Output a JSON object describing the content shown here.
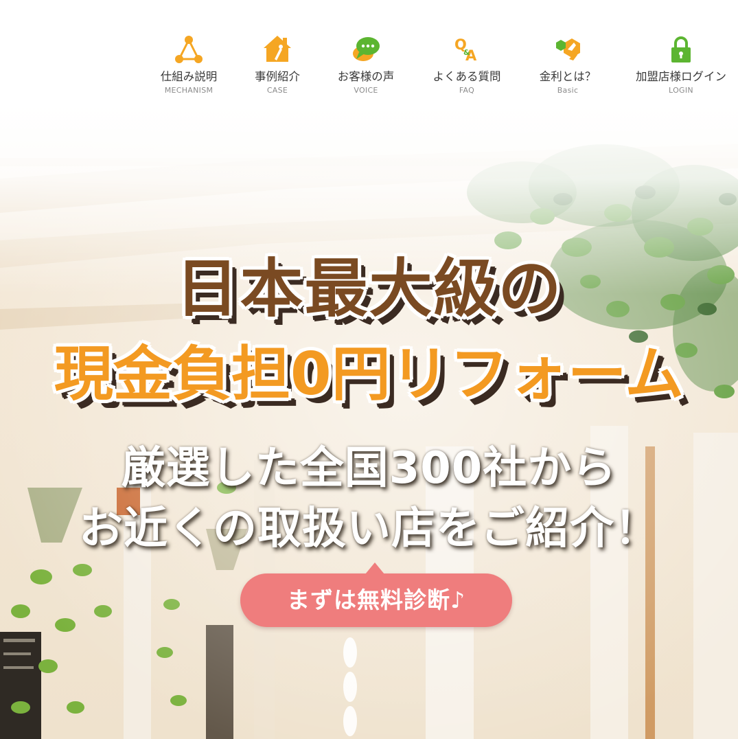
{
  "nav": {
    "items": [
      {
        "label": "仕組み説明",
        "sub": "MECHANISM",
        "icon": "mechanism-triangle-icon"
      },
      {
        "label": "事例紹介",
        "sub": "CASE",
        "icon": "house-icon"
      },
      {
        "label": "お客様の声",
        "sub": "VOICE",
        "icon": "speech-bubble-icon"
      },
      {
        "label": "よくある質問",
        "sub": "FAQ",
        "icon": "qa-icon"
      },
      {
        "label": "金利とは？",
        "sub": "Basic",
        "icon": "hexagon-shapes-icon"
      },
      {
        "label": "加盟店様ログイン",
        "sub": "LOGIN",
        "icon": "lock-icon"
      }
    ]
  },
  "hero": {
    "headline_line1": "日本最大級の",
    "headline_line2": "現金負担0円リフォーム",
    "subheadline_line1": "厳選した全国300社から",
    "subheadline_line2": "お近くの取扱い店をご紹介！",
    "cta_label": "まずは無料診断♪"
  },
  "colors": {
    "brown": "#7a4a22",
    "orange": "#f39a22",
    "cta_pink": "#ef7d7d",
    "icon_orange": "#f5a623",
    "icon_green": "#5cb531"
  }
}
